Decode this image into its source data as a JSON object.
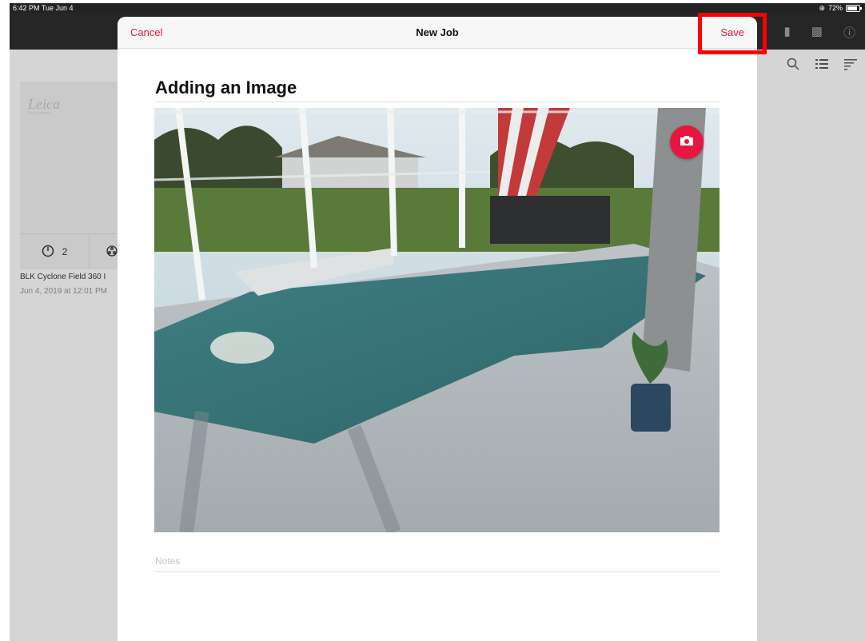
{
  "status_bar": {
    "time": "6:42 PM  Tue Jun 4",
    "battery": "72%",
    "battery_level": 0.72
  },
  "background_job": {
    "logo_text": "Leica",
    "logo_subtext": "Geosystems",
    "setups_count": "2",
    "title": "BLK Cyclone Field 360 I",
    "date": "Jun 4, 2019 at 12:01 PM"
  },
  "modal": {
    "cancel_label": "Cancel",
    "title": "New Job",
    "save_label": "Save",
    "heading": "Adding an Image",
    "notes_placeholder": "Notes"
  },
  "icons": {
    "camera": "camera-icon",
    "search": "search-icon",
    "list": "list-icon",
    "sort": "sort-icon",
    "info": "info-icon",
    "device": "device-icon",
    "battery": "battery-icon",
    "gauge": "gauge-icon",
    "network": "network-icon"
  },
  "colors": {
    "accent": "#e2173b",
    "highlight": "#ff0000"
  }
}
